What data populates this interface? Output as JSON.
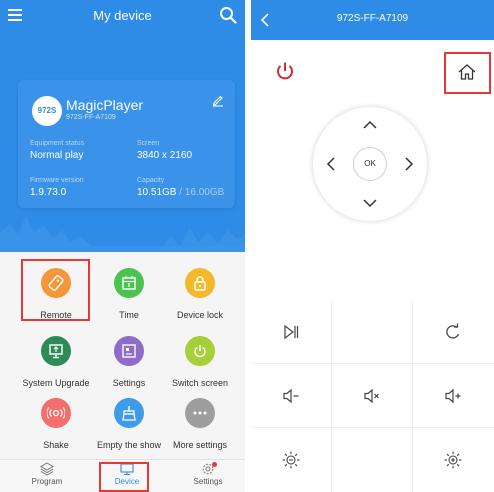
{
  "left": {
    "header": {
      "title": "My device",
      "menu_icon": "hamburger-menu-icon",
      "search_icon": "search-icon"
    },
    "device": {
      "badge": "972S",
      "name": "MagicPlayer",
      "serial": "972S-FF-A7109",
      "equipment_status_label": "Equipment status",
      "equipment_status_value": "Normal play",
      "screen_label": "Screen",
      "screen_value": "3840 x 2160",
      "firmware_label": "Firmware version",
      "firmware_value": "1.9.73.0",
      "capacity_label": "Capacity",
      "capacity_used": "10.51GB",
      "capacity_total": " / 16.00GB"
    },
    "functions": [
      {
        "label": "Remote",
        "icon": "remote-control-icon",
        "color": "#f5963a"
      },
      {
        "label": "Time",
        "icon": "calendar-icon",
        "color": "#4cc34f"
      },
      {
        "label": "Device lock",
        "icon": "lock-icon",
        "color": "#f3b82c"
      },
      {
        "label": "System Upgrade",
        "icon": "upgrade-icon",
        "color": "#2e8b57"
      },
      {
        "label": "Settings",
        "icon": "settings-panel-icon",
        "color": "#8e6cc9"
      },
      {
        "label": "Switch screen",
        "icon": "power-switch-icon",
        "color": "#a6cf3a"
      },
      {
        "label": "Shake",
        "icon": "shake-icon",
        "color": "#f16f6c"
      },
      {
        "label": "Empty the show",
        "icon": "broom-icon",
        "color": "#3d9be9"
      },
      {
        "label": "More settings",
        "icon": "more-dots-icon",
        "color": "#9e9e9e"
      }
    ],
    "tabs": [
      {
        "label": "Program",
        "icon": "layers-icon"
      },
      {
        "label": "Device",
        "icon": "monitor-icon"
      },
      {
        "label": "Settings",
        "icon": "gear-icon"
      }
    ]
  },
  "right": {
    "header": {
      "title": "972S-FF-A7109",
      "back_icon": "chevron-left-icon"
    },
    "ok_label": "OK",
    "icons": {
      "power": "power-icon",
      "home": "home-icon",
      "play_pause": "play-pause-icon",
      "refresh": "refresh-icon",
      "volume_down": "volume-down-icon",
      "mute": "mute-icon",
      "volume_up": "volume-up-icon",
      "brightness_down": "brightness-down-icon",
      "brightness_up": "brightness-up-icon"
    }
  },
  "colors": {
    "primary_blue": "#2f8ce6",
    "highlight_red": "#e53935",
    "power_red": "#d32f2f"
  }
}
